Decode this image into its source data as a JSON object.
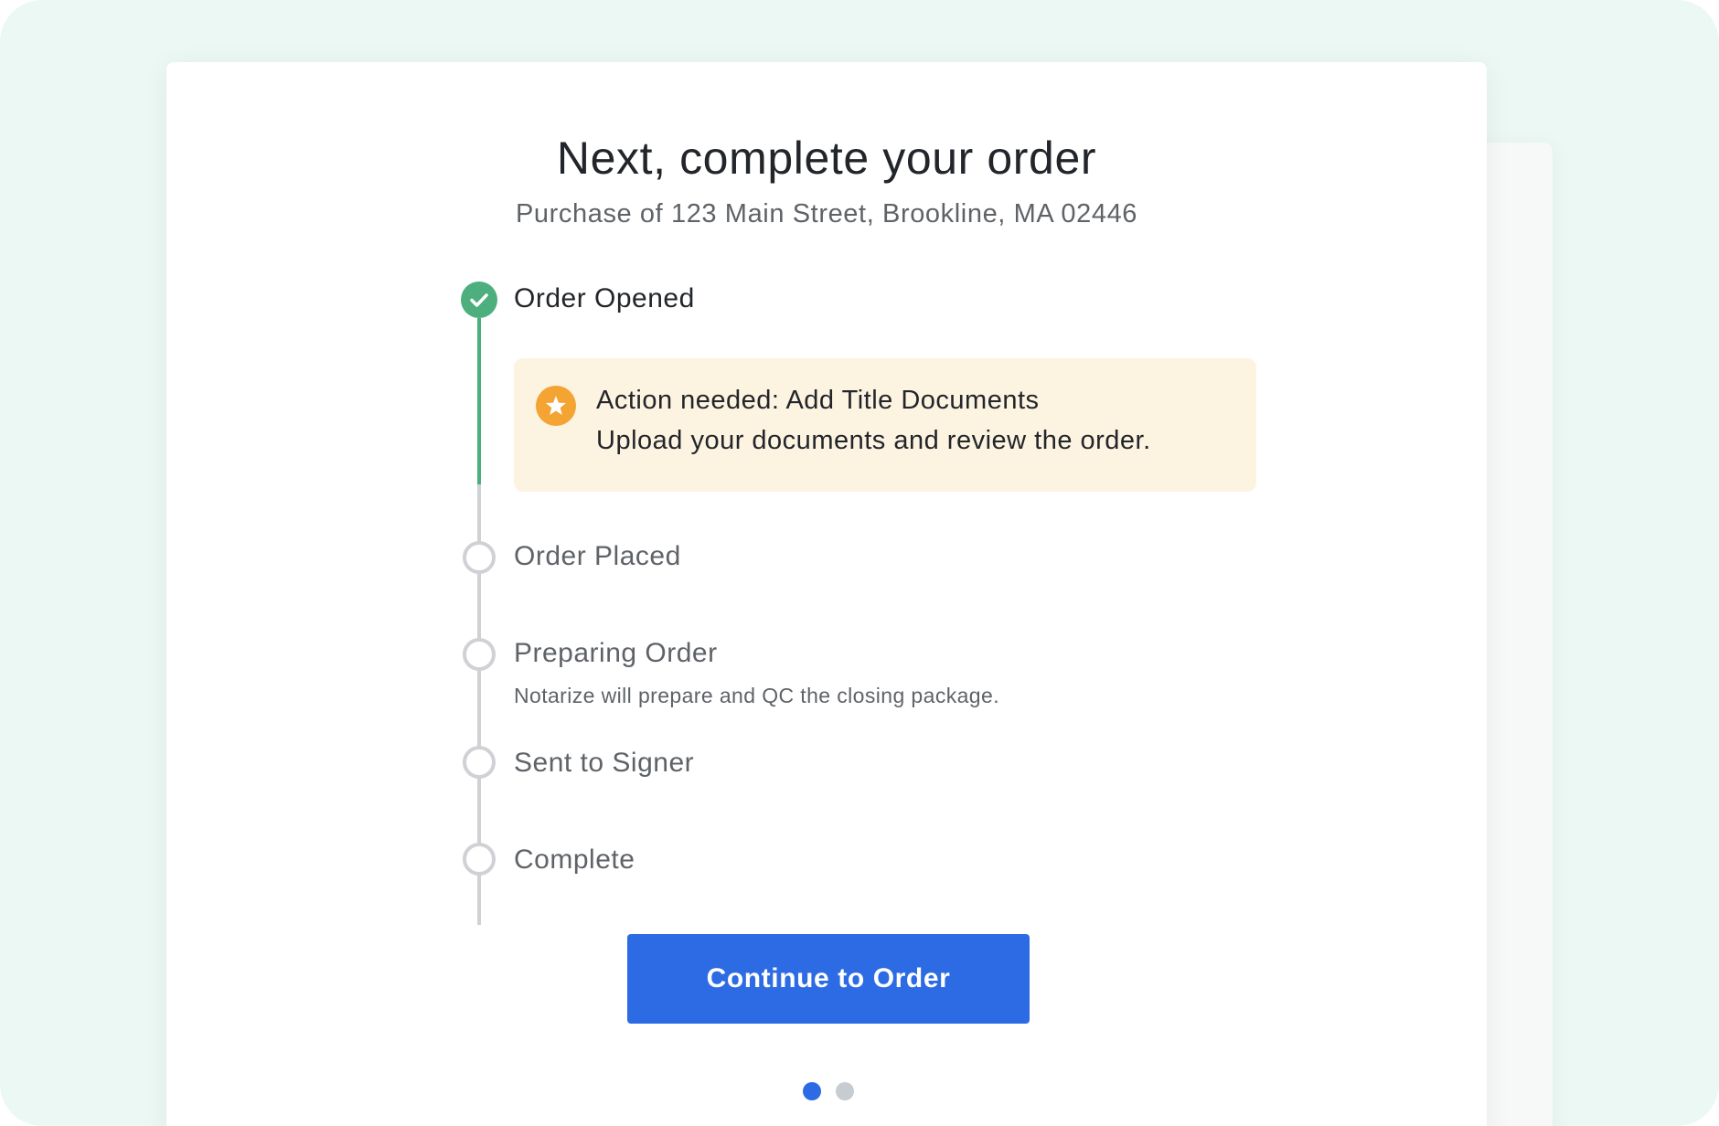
{
  "header": {
    "title": "Next, complete your order",
    "subtitle": "Purchase of 123 Main Street, Brookline, MA 02446"
  },
  "steps": [
    {
      "label": "Order Opened",
      "status": "complete"
    },
    {
      "label": "Order Placed",
      "status": "pending"
    },
    {
      "label": "Preparing Order",
      "status": "pending",
      "description": "Notarize will prepare and QC the closing package."
    },
    {
      "label": "Sent to Signer",
      "status": "pending"
    },
    {
      "label": "Complete",
      "status": "pending"
    }
  ],
  "alert": {
    "title": "Action needed: Add Title Documents",
    "body": "Upload your documents and review the order.",
    "icon": "star-icon"
  },
  "primary_button": {
    "label": "Continue to Order"
  },
  "pagination": {
    "current_page": 1,
    "total_pages": 2
  },
  "colors": {
    "accent": "#2d6be4",
    "complete": "#4caf7d",
    "pending": "#cfd1d4",
    "alert_bg": "#fdf3e1",
    "alert_icon": "#f3a433",
    "background": "#ebf8f3"
  }
}
